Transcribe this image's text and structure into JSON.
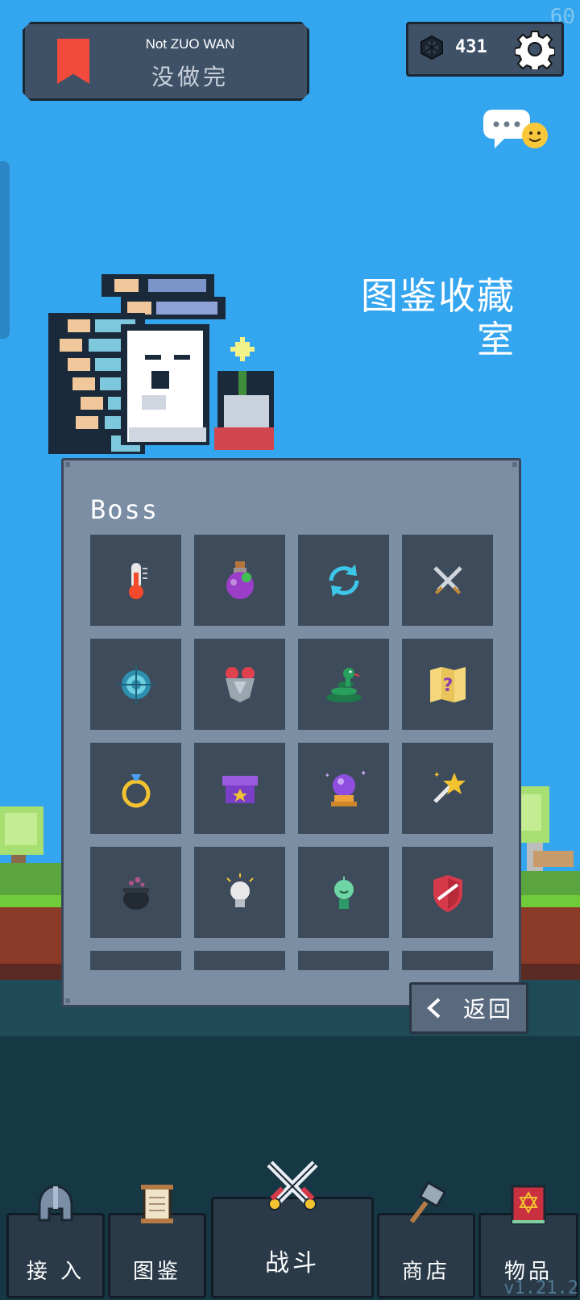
{
  "status_bar": {
    "fps": "60"
  },
  "header": {
    "player_name": "Not ZUO WAN",
    "player_status": "没做完",
    "gem_count": "431"
  },
  "room": {
    "title_line1": "图鉴收藏",
    "title_line2": "室"
  },
  "panel": {
    "title": "Boss",
    "items": [
      {
        "icon": "thermometer-icon"
      },
      {
        "icon": "potion-icon"
      },
      {
        "icon": "refresh-cycle-icon"
      },
      {
        "icon": "crossed-swords-icon"
      },
      {
        "icon": "target-icon"
      },
      {
        "icon": "heart-armor-icon"
      },
      {
        "icon": "snake-icon"
      },
      {
        "icon": "mystery-map-icon"
      },
      {
        "icon": "ring-icon"
      },
      {
        "icon": "treasure-chest-icon"
      },
      {
        "icon": "crystal-ball-icon"
      },
      {
        "icon": "magic-wand-icon"
      },
      {
        "icon": "cauldron-icon"
      },
      {
        "icon": "lightbulb-icon"
      },
      {
        "icon": "spirit-icon"
      },
      {
        "icon": "shield-icon"
      }
    ]
  },
  "back_button": {
    "label": "返回"
  },
  "nav": {
    "items": [
      {
        "label": "接 入",
        "icon": "helmet-icon"
      },
      {
        "label": "图鉴",
        "icon": "scroll-icon"
      },
      {
        "label": "战斗",
        "icon": "crossed-swords-icon"
      },
      {
        "label": "商店",
        "icon": "hammer-icon"
      },
      {
        "label": "物品",
        "icon": "spellbook-icon"
      }
    ]
  },
  "version": "v1.21.2",
  "colors": {
    "sky": "#34a5ef",
    "panel": "#7b8ea3",
    "cell": "#3e4b5b",
    "nav": "#2a3a48",
    "bookmark": "#f24a3c"
  }
}
